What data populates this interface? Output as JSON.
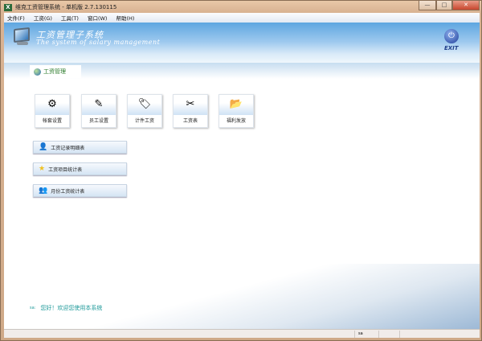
{
  "window": {
    "title": "维克工资管理系统 - 单机版 2.7.130115",
    "logo": "X",
    "controls": [
      "—",
      "□",
      "✕"
    ]
  },
  "menu": [
    "文件(F)",
    "工资(G)",
    "工具(T)",
    "窗口(W)",
    "帮助(H)"
  ],
  "header": {
    "title": "工资管理子系统",
    "subtitle": "The system of salary management",
    "exit_label": "EXIT"
  },
  "tab": {
    "label": "工资管理"
  },
  "big_buttons": [
    {
      "label": "帐套设置",
      "icon": "gear-icon",
      "glyph": "⚙"
    },
    {
      "label": "员工设置",
      "icon": "pen-icon",
      "glyph": "✎"
    },
    {
      "label": "计件工资",
      "icon": "tag-icon",
      "glyph": "🏷"
    },
    {
      "label": "工资表",
      "icon": "chart-sheet-icon",
      "glyph": "✂"
    },
    {
      "label": "福利发放",
      "icon": "folder-icon",
      "glyph": "📂"
    }
  ],
  "wide_buttons": [
    {
      "label": "工资记录明细表",
      "icon": "user-list-icon",
      "glyph": "👤"
    },
    {
      "label": "工资项目统计表",
      "icon": "star-icon",
      "glyph": "★"
    },
    {
      "label": "月份工资统计表",
      "icon": "users-icon",
      "glyph": "👥"
    }
  ],
  "welcome": {
    "prefix": "sa:",
    "text": "您好！欢迎您使用本系统"
  },
  "status": {
    "cell": "sa"
  }
}
